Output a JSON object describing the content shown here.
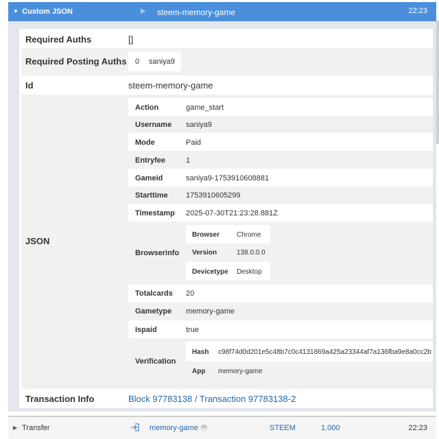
{
  "header": {
    "title": "Custom JSON",
    "id": "steem-memory-game",
    "time": "22:23"
  },
  "details": {
    "required_auths_label": "Required Auths",
    "required_auths_value": "[]",
    "required_posting_auths_label": "Required Posting Auths",
    "posting_auths": {
      "index": "0",
      "name": "saniya9"
    },
    "id_label": "Id",
    "id_value": "steem-memory-game",
    "json_label": "JSON",
    "json": {
      "action_label": "Action",
      "action": "game_start",
      "username_label": "Username",
      "username": "saniya9",
      "mode_label": "Mode",
      "mode": "Paid",
      "entryfee_label": "Entryfee",
      "entryfee": "1",
      "gameid_label": "Gameid",
      "gameid": "saniya9-1753910608881",
      "starttime_label": "Starttime",
      "starttime": "1753910605299",
      "timestamp_label": "Timestamp",
      "timestamp": "2025-07-30T21:23:28.881Z",
      "browserinfo_label": "Browserinfo",
      "browserinfo": {
        "browser_label": "Browser",
        "browser": "Chrome",
        "version_label": "Version",
        "version": "138.0.0.0",
        "devicetype_label": "Devicetype",
        "devicetype": "Desktop"
      },
      "totalcards_label": "Totalcards",
      "totalcards": "20",
      "gametype_label": "Gametype",
      "gametype": "memory-game",
      "ispaid_label": "Ispaid",
      "ispaid": "true",
      "verification_label": "Verification",
      "verification": {
        "hash_label": "Hash",
        "hash": "c98f74d0d201e5c48b7c0c4131869a425a23344af7a136fba9e8a0cc2b",
        "app_label": "App",
        "app": "memory-game"
      }
    },
    "transaction_info_label": "Transaction Info",
    "block_link": "Block 97783138",
    "separator": " / ",
    "transaction_link": "Transaction 97783138-2"
  },
  "transfer": {
    "title": "Transfer",
    "account": "memory-game",
    "reputation": "64",
    "currency": "STEEM",
    "amount": "1.000",
    "time": "22:23"
  },
  "colors": {
    "header_bg": "#4a8fdc",
    "panel_bg": "#e2e7ee",
    "link": "#2266aa",
    "alt_row": "#f1f1f1"
  },
  "icons": {
    "expand": "triangle-down",
    "collapsed": "triangle-right",
    "play": "play-triangle",
    "login": "login-arrow"
  }
}
